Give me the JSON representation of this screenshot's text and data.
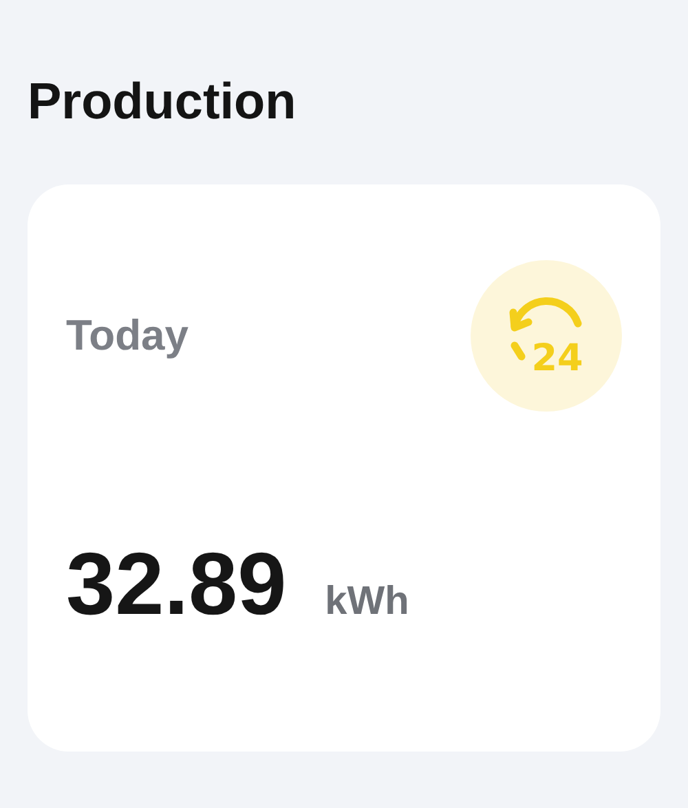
{
  "section_title": "Production",
  "card": {
    "label": "Today",
    "icon_label": "24",
    "value": "32.89",
    "unit": "kWh"
  }
}
